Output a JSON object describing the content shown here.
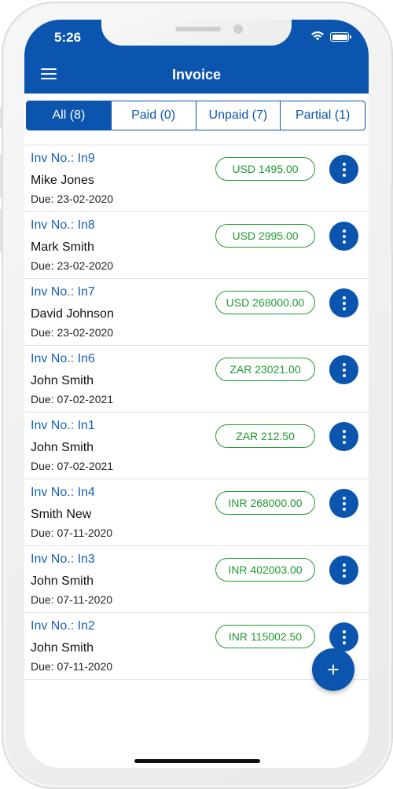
{
  "status_bar": {
    "time": "5:26"
  },
  "header": {
    "title": "Invoice"
  },
  "tabs": [
    {
      "label": "All (8)",
      "active": true
    },
    {
      "label": "Paid (0)",
      "active": false
    },
    {
      "label": "Unpaid (7)",
      "active": false
    },
    {
      "label": "Partial (1)",
      "active": false
    }
  ],
  "invoices": [
    {
      "number": "Inv No.: In9",
      "customer": "Mike Jones",
      "due": "Due: 23-02-2020",
      "amount": "USD 1495.00"
    },
    {
      "number": "Inv No.: In8",
      "customer": "Mark Smith",
      "due": "Due: 23-02-2020",
      "amount": "USD 2995.00"
    },
    {
      "number": "Inv No.: In7",
      "customer": "David Johnson",
      "due": "Due: 23-02-2020",
      "amount": "USD 268000.00"
    },
    {
      "number": "Inv No.: In6",
      "customer": "John Smith",
      "due": "Due: 07-02-2021",
      "amount": "ZAR 23021.00"
    },
    {
      "number": "Inv No.: In1",
      "customer": "John Smith",
      "due": "Due: 07-02-2021",
      "amount": "ZAR 212.50"
    },
    {
      "number": "Inv No.: In4",
      "customer": "Smith New",
      "due": "Due: 07-11-2020",
      "amount": "INR 268000.00"
    },
    {
      "number": "Inv No.: In3",
      "customer": "John Smith",
      "due": "Due: 07-11-2020",
      "amount": "INR 402003.00"
    },
    {
      "number": "Inv No.: In2",
      "customer": "John Smith",
      "due": "Due: 07-11-2020",
      "amount": "INR 115002.50"
    }
  ],
  "fab": {
    "label": "+"
  },
  "colors": {
    "primary": "#0b55ae",
    "amount": "#1f9a2e",
    "invoice_number": "#1762b4"
  },
  "icons": {
    "menu": "hamburger-menu-icon",
    "more": "more-vertical-icon",
    "add": "plus-icon"
  }
}
